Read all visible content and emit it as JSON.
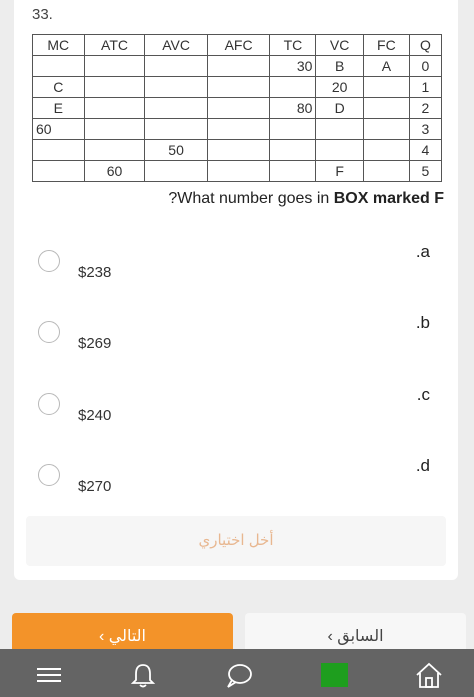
{
  "question": {
    "number": "33.",
    "text_prefix": "?What number goes in ",
    "text_bold": "BOX marked F"
  },
  "table": {
    "headers": [
      "MC",
      "ATC",
      "AVC",
      "AFC",
      "TC",
      "VC",
      "FC",
      "Q"
    ],
    "rows": [
      [
        "",
        "",
        "",
        "",
        "30",
        "B",
        "A",
        "0"
      ],
      [
        "C",
        "",
        "",
        "",
        "",
        "20",
        "",
        "1"
      ],
      [
        "E",
        "",
        "",
        "",
        "80",
        "D",
        "",
        "2"
      ],
      [
        "60",
        "",
        "",
        "",
        "",
        "",
        "",
        "3"
      ],
      [
        "",
        "",
        "50",
        "",
        "",
        "",
        "",
        "4"
      ],
      [
        "",
        "60",
        "",
        "",
        "",
        "F",
        "",
        "5"
      ]
    ]
  },
  "options": [
    {
      "letter": ".a",
      "value": "$238"
    },
    {
      "letter": ".b",
      "value": "$269"
    },
    {
      "letter": ".c",
      "value": "$240"
    },
    {
      "letter": ".d",
      "value": "$270"
    }
  ],
  "submit_label": "أخل اختياري",
  "nav": {
    "next_label": "التالي",
    "prev_label": "السابق"
  },
  "colors": {
    "accent": "#f39329",
    "tabbar": "#646464",
    "active_tab": "#1e9e1e"
  },
  "tabbar_icons": [
    "menu-icon",
    "bell-icon",
    "chat-icon",
    "active-square-icon",
    "home-icon"
  ]
}
